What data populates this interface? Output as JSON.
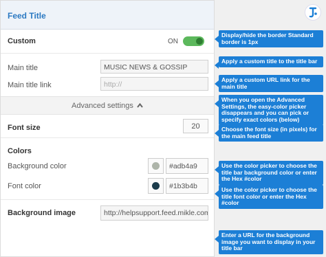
{
  "header": {
    "title": "Feed Title"
  },
  "custom": {
    "label": "Custom",
    "state": "ON",
    "enabled": true
  },
  "main_title": {
    "label": "Main title",
    "value": "MUSIC NEWS & GOSSIP"
  },
  "main_title_link": {
    "label": "Main title link",
    "placeholder": "http://"
  },
  "advanced": {
    "label": "Advanced settings"
  },
  "font_size": {
    "label": "Font size",
    "value": "20"
  },
  "colors": {
    "heading": "Colors",
    "background": {
      "label": "Background color",
      "hex": "#adb4a9"
    },
    "font": {
      "label": "Font color",
      "hex": "#1b3b4b"
    }
  },
  "background_image": {
    "label": "Background image",
    "value": "http://helpsupport.feed.mikle.com/sup"
  },
  "callouts": [
    "Display/hide the border Standard border is 1px",
    "Apply a custom title to the title bar",
    "Apply a custom URL link for the main title",
    "When you open the Advanced Settings, the easy-color picker disappears and you can pick or specify exact colors (below)",
    "Choose the font size (in pixels) for the main feed title",
    "Use the color picker to choose the title bar background color or enter the Hex #color",
    "Use the color picker to choose the title font color or enter the Hex #color",
    "Enter a URL for the background image you want to display in your title bar"
  ],
  "theme": {
    "accent": "#2b79c2",
    "callout": "#1c7fd6",
    "toggle": "#5cb85c"
  },
  "icons": {
    "logo": "feed-logo-icon",
    "chevron": "chevron-up-icon"
  }
}
